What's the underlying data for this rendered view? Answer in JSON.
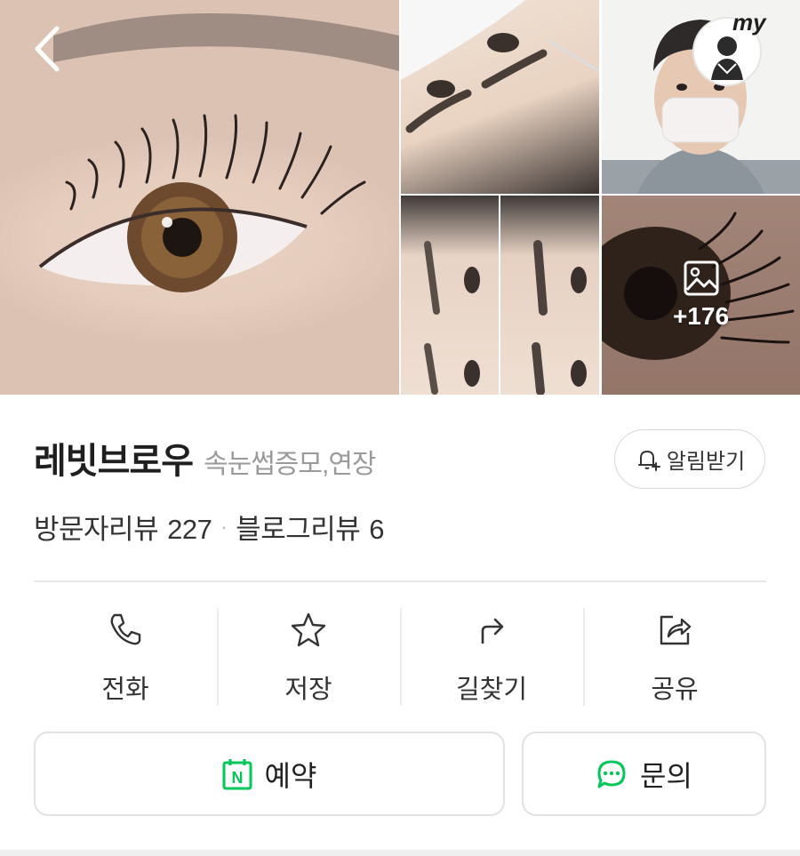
{
  "header": {
    "back_icon": "chevron-left-icon",
    "my_badge_text": "my"
  },
  "gallery": {
    "more_count": "+176",
    "more_icon": "image-icon"
  },
  "place": {
    "name": "레빗브로우",
    "category": "속눈썹증모,연장"
  },
  "notify": {
    "label": "알림받기",
    "icon": "bell-plus-icon"
  },
  "reviews": {
    "visitor_label": "방문자리뷰",
    "visitor_count": "227",
    "separator": "·",
    "blog_label": "블로그리뷰",
    "blog_count": "6"
  },
  "actions": [
    {
      "label": "전화",
      "icon": "phone-icon"
    },
    {
      "label": "저장",
      "icon": "star-icon"
    },
    {
      "label": "길찾기",
      "icon": "directions-icon"
    },
    {
      "label": "공유",
      "icon": "share-icon"
    }
  ],
  "buttons": {
    "reserve_label": "예약",
    "reserve_icon_letter": "N",
    "inquiry_label": "문의"
  },
  "colors": {
    "accent_green": "#03c75a",
    "text": "#222222",
    "muted": "#9a9a9a"
  }
}
